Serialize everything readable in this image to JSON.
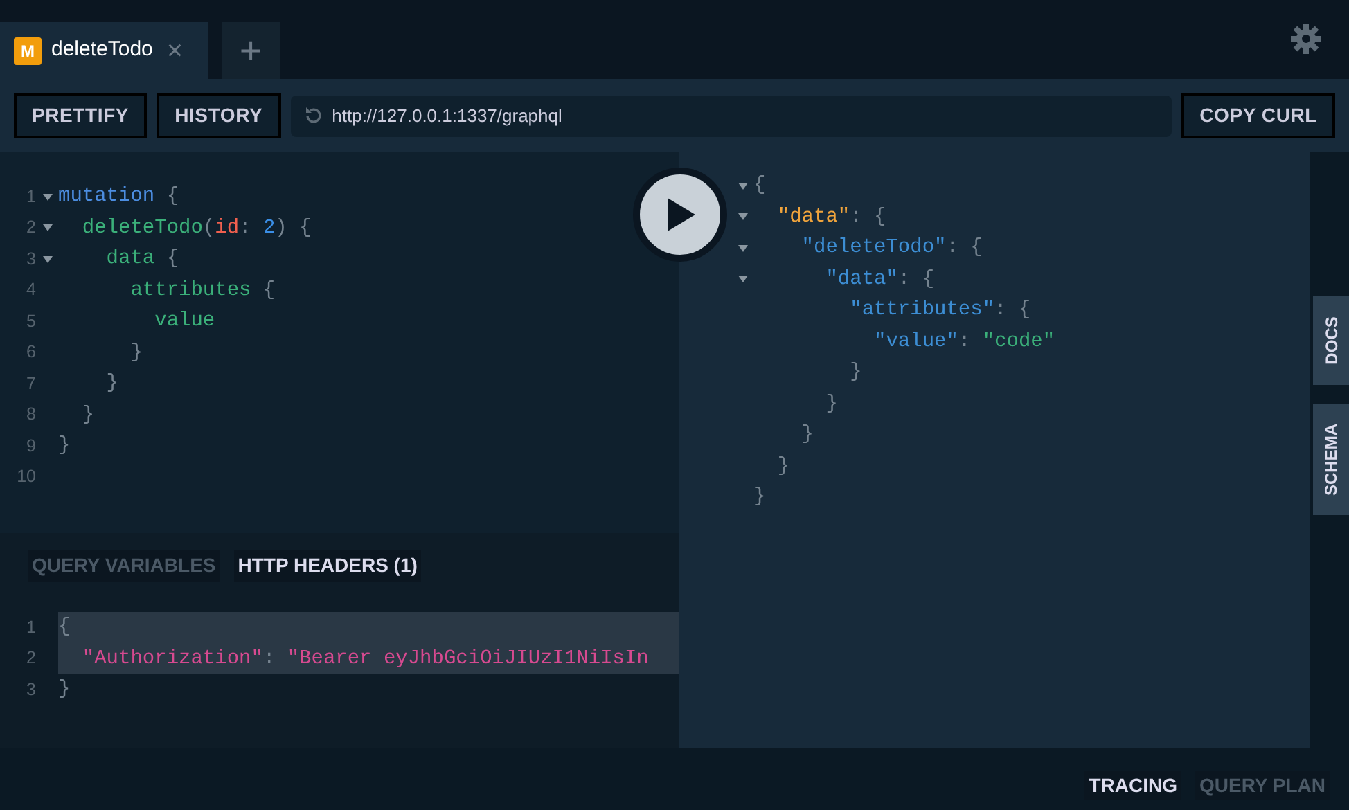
{
  "tabs": [
    {
      "badge": "M",
      "label": "deleteTodo",
      "close": "×",
      "selected": true
    }
  ],
  "new_tab": "+",
  "toolbar": {
    "buttons": [
      "PRETTIFY",
      "HISTORY"
    ],
    "url": "http://127.0.0.1:1337/graphql",
    "copy_button": "COPY CURL"
  },
  "query_editor": {
    "lines": [
      {
        "number": "1",
        "fold": true,
        "tokens": [
          {
            "kind": "keyword",
            "text": "mutation"
          },
          {
            "kind": "punct",
            "text": " {"
          }
        ]
      },
      {
        "number": "2",
        "fold": true,
        "tokens": [
          {
            "kind": "field",
            "text": "  deleteTodo"
          },
          {
            "kind": "punct",
            "text": "("
          },
          {
            "kind": "argument",
            "text": "id"
          },
          {
            "kind": "punct",
            "text": ": "
          },
          {
            "kind": "number",
            "text": "2"
          },
          {
            "kind": "punct",
            "text": ") {"
          }
        ]
      },
      {
        "number": "3",
        "fold": true,
        "tokens": [
          {
            "kind": "field",
            "text": "    data"
          },
          {
            "kind": "punct",
            "text": " {"
          }
        ]
      },
      {
        "number": "4",
        "fold": false,
        "tokens": [
          {
            "kind": "field",
            "text": "      attributes"
          },
          {
            "kind": "punct",
            "text": " {"
          }
        ]
      },
      {
        "number": "5",
        "fold": false,
        "tokens": [
          {
            "kind": "field",
            "text": "        value"
          }
        ]
      },
      {
        "number": "6",
        "fold": false,
        "tokens": [
          {
            "kind": "punct",
            "text": "      }"
          }
        ]
      },
      {
        "number": "7",
        "fold": false,
        "tokens": [
          {
            "kind": "punct",
            "text": "    }"
          }
        ]
      },
      {
        "number": "8",
        "fold": false,
        "tokens": [
          {
            "kind": "punct",
            "text": "  }"
          }
        ]
      },
      {
        "number": "9",
        "fold": false,
        "tokens": [
          {
            "kind": "punct",
            "text": "}"
          }
        ]
      },
      {
        "number": "10",
        "fold": false
      }
    ]
  },
  "variable_tabs": [
    {
      "label": "QUERY VARIABLES",
      "selected": false
    },
    {
      "label": "HTTP HEADERS (1)",
      "selected": true
    }
  ],
  "headers_editor": {
    "lines": [
      {
        "number": "1",
        "highlighted": true,
        "tokens": [
          {
            "kind": "punct",
            "text": "{"
          }
        ]
      },
      {
        "number": "2",
        "highlighted": true,
        "tokens": [
          {
            "kind": "header",
            "text": "  \"Authorization\""
          },
          {
            "kind": "punct",
            "text": ": "
          },
          {
            "kind": "header",
            "text": "\"Bearer eyJhbGciOiJIUzI1NiIsIn"
          }
        ]
      },
      {
        "number": "3",
        "highlighted": false,
        "tokens": [
          {
            "kind": "punct",
            "text": "}"
          }
        ]
      }
    ]
  },
  "response": {
    "lines": [
      {
        "fold": true,
        "tokens": [
          {
            "kind": "punct",
            "text": "{"
          }
        ]
      },
      {
        "fold": true,
        "tokens": [
          {
            "kind": "rootkey",
            "text": "  \"data\""
          },
          {
            "kind": "punct",
            "text": ": {"
          }
        ]
      },
      {
        "fold": true,
        "tokens": [
          {
            "kind": "key",
            "text": "    \"deleteTodo\""
          },
          {
            "kind": "punct",
            "text": ": {"
          }
        ]
      },
      {
        "fold": true,
        "tokens": [
          {
            "kind": "key",
            "text": "      \"data\""
          },
          {
            "kind": "punct",
            "text": ": {"
          }
        ]
      },
      {
        "fold": false,
        "tokens": [
          {
            "kind": "key",
            "text": "        \"attributes\""
          },
          {
            "kind": "punct",
            "text": ": {"
          }
        ]
      },
      {
        "fold": false,
        "tokens": [
          {
            "kind": "key",
            "text": "          \"value\""
          },
          {
            "kind": "punct",
            "text": ": "
          },
          {
            "kind": "string",
            "text": "\"code\""
          }
        ]
      },
      {
        "fold": false,
        "tokens": [
          {
            "kind": "punct",
            "text": "        }"
          }
        ]
      },
      {
        "fold": false,
        "tokens": [
          {
            "kind": "punct",
            "text": "      }"
          }
        ]
      },
      {
        "fold": false,
        "tokens": [
          {
            "kind": "punct",
            "text": "    }"
          }
        ]
      },
      {
        "fold": false,
        "tokens": [
          {
            "kind": "punct",
            "text": "  }"
          }
        ]
      },
      {
        "fold": false,
        "tokens": [
          {
            "kind": "punct",
            "text": "}"
          }
        ]
      }
    ]
  },
  "side_tabs": [
    "DOCS",
    "SCHEMA"
  ],
  "footer_tabs": [
    {
      "label": "TRACING",
      "selected": true
    },
    {
      "label": "QUERY PLAN",
      "selected": false
    }
  ]
}
